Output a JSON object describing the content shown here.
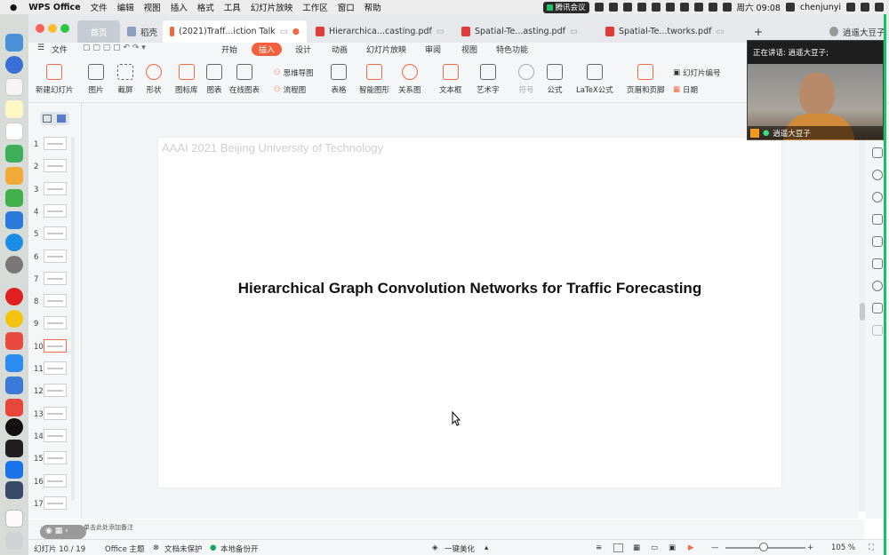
{
  "menubar": {
    "app_name": "WPS Office",
    "items": [
      "文件",
      "编辑",
      "视图",
      "插入",
      "格式",
      "工具",
      "幻灯片放映",
      "工作区",
      "窗口",
      "帮助"
    ],
    "meeting_badge": "腾讯会议",
    "datetime": "周六 09:08",
    "user": "chenjunyi"
  },
  "tabs": [
    {
      "label": "首页"
    },
    {
      "label": "稻壳"
    },
    {
      "label": "(2021)Traff...iction Talk"
    },
    {
      "label": "Hierarchica...casting.pdf"
    },
    {
      "label": "Spatial-Te...asting.pdf"
    },
    {
      "label": "Spatial-Te...tworks.pdf"
    }
  ],
  "account": "逍遥大豆子",
  "ribbon": {
    "file_label": "文件",
    "tabs": [
      "开始",
      "插入",
      "设计",
      "动画",
      "幻灯片放映",
      "审阅",
      "视图",
      "特色功能"
    ],
    "active_tab": "插入",
    "tools": [
      "新建幻灯片",
      "图片",
      "截屏",
      "形状",
      "图标库",
      "图表",
      "在线图表",
      "表格",
      "智能图形",
      "关系图",
      "文本框",
      "艺术字",
      "符号",
      "公式",
      "LaTeX公式",
      "页眉和页脚"
    ],
    "mindmap": "思维导图",
    "flowchart": "流程图",
    "slide_number": "幻灯片编号",
    "date": "日期"
  },
  "thumbnails": [
    "1",
    "2",
    "3",
    "4",
    "5",
    "6",
    "7",
    "8",
    "9",
    "10",
    "11",
    "12",
    "13",
    "14",
    "15",
    "16",
    "17"
  ],
  "selected_slide": "10",
  "slide": {
    "header": "AAAI 2021  Beijing University of Technology",
    "title": "Hierarchical Graph Convolution Networks for Traffic Forecasting"
  },
  "notes_placeholder": "单击此处添加备注",
  "status": {
    "slide_counter": "幻灯片 10 / 19",
    "theme": "Office 主题",
    "doc_protect": "文档未保护",
    "backup": "本地备份开",
    "beautify": "一键美化",
    "zoom": "105 %"
  },
  "video": {
    "speaking": "正在讲话: 逍遥大豆子;",
    "name": "逍遥大豆子"
  },
  "colors": {
    "accent": "#f2603e",
    "meeting_green": "#19c267"
  }
}
